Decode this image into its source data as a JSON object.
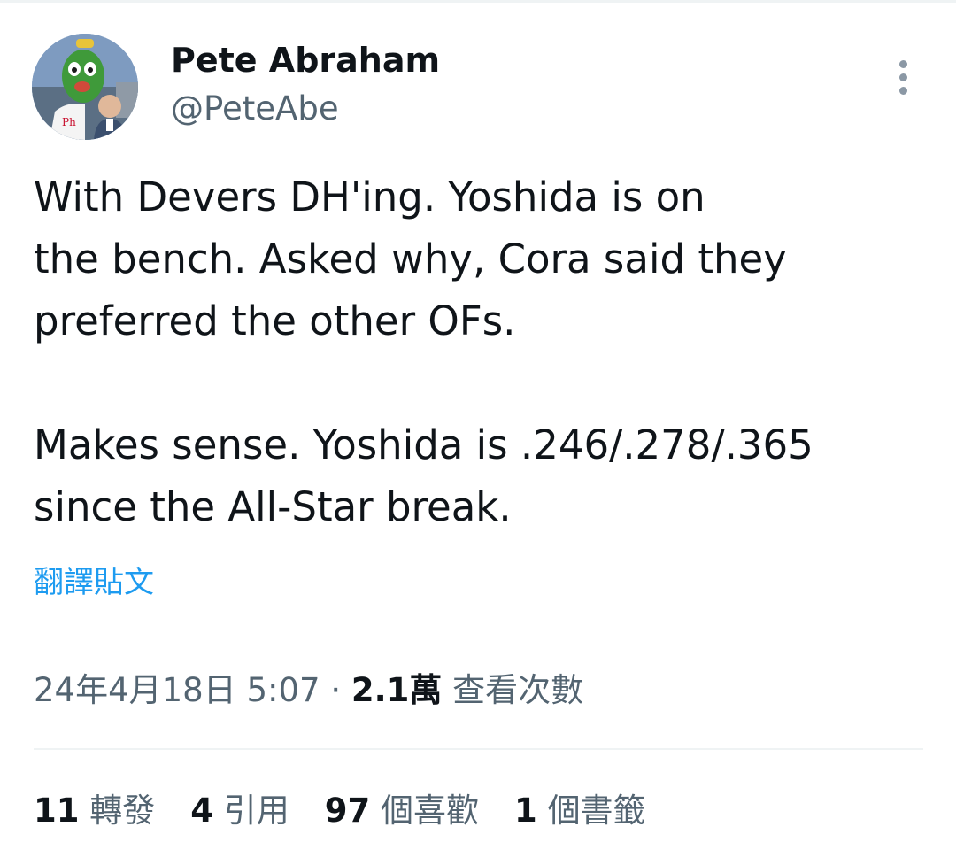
{
  "author": {
    "display_name": "Pete Abraham",
    "handle": "@PeteAbe",
    "avatar_icon": "avatar-photo"
  },
  "menu": {
    "icon": "more-vertical-icon"
  },
  "tweet": {
    "text": "With Devers DH'ing. Yoshida is on\nthe bench. Asked why, Cora said they\npreferred the other OFs.\n\nMakes sense. Yoshida is .246/.278/.365\nsince the All-Star break.",
    "translate_label": "翻譯貼文"
  },
  "meta": {
    "timestamp": "24年4月18日 5:07",
    "separator": " · ",
    "views_count": "2.1萬",
    "views_label": " 查看次數"
  },
  "stats": [
    {
      "count": "11",
      "label": "轉發"
    },
    {
      "count": "4",
      "label": "引用"
    },
    {
      "count": "97",
      "label": "個喜歡"
    },
    {
      "count": "1",
      "label": "個書籤"
    }
  ],
  "colors": {
    "text_primary": "#0f1419",
    "text_secondary": "#536471",
    "link": "#1d9bf0",
    "divider": "#eff3f4"
  }
}
